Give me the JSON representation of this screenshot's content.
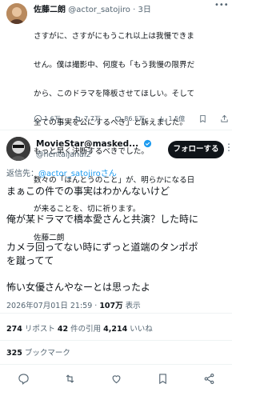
{
  "quoted": {
    "name": "佐藤二朗",
    "handle": "@actor_satojiro",
    "time": "3日",
    "lines": [
      "さすがに、さすがにもうこれ以上は我慢できま",
      "せん。僕は撮影中、何度も「もう我慢の限界だ",
      "から、このドラマを降板させてほしい。そして",
      "全ての事実を公にするべき」と訴えました。",
      "もっと早く決断するべきでした。",
      "数々の「ほんとうのこと」が、明らかになる日",
      "が来ることを、切に祈ります。",
      "佐藤二朗"
    ],
    "actions": {
      "replies": "1.6万",
      "retweets": "7.7万",
      "likes": "86.5万",
      "views": "1.5億"
    }
  },
  "author": {
    "display_name": "MovieStar@masked...",
    "handle": "@hentaijanai2",
    "follow_label": "フォローする"
  },
  "reply_to": {
    "prefix": "返信先：",
    "handle": "@actor_satojiro",
    "suffix": "さん"
  },
  "tweet": {
    "lines": [
      "まぁこの件での事実はわかんないけど",
      "俺が某ドラマで橋本愛さんと共演？した時に",
      "カメラ回ってない時にずっと道端のタンポポ",
      "を蹴ってて",
      "怖い女優さんやなーとは思ったよ"
    ]
  },
  "timestamp": {
    "text": "2026年07月01日 21:59 · ",
    "views": "107万",
    "views_label": " 表示"
  },
  "stats": {
    "retweets": "274",
    "retweets_label": " リポスト  ",
    "quotes": "42",
    "quotes_label": " 件の引用  ",
    "likes": "4,214",
    "likes_label": " いいね"
  },
  "bookmarks": {
    "count": "325",
    "label": " ブックマーク"
  },
  "icons": {
    "more": "more-horizontal-icon",
    "verified": "verified-badge-icon",
    "reply": "reply-icon",
    "retweet": "retweet-icon",
    "like": "heart-icon",
    "views": "views-chart-icon",
    "bookmark": "bookmark-icon",
    "share": "share-icon"
  },
  "colors": {
    "accent": "#1d9bf0",
    "muted": "#536471",
    "text": "#0f1419"
  }
}
